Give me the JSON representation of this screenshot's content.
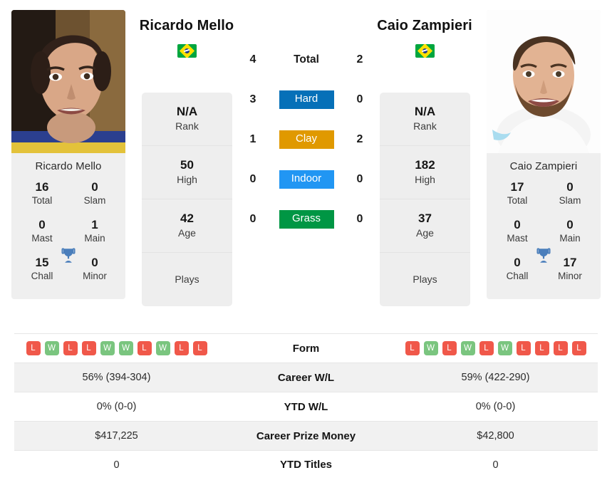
{
  "players": {
    "left": {
      "name": "Ricardo Mello",
      "photo_name": "Ricardo Mello",
      "flag": "brazil-flag",
      "rank": "N/A",
      "rank_label": "Rank",
      "high": "50",
      "high_label": "High",
      "age": "42",
      "age_label": "Age",
      "plays": "",
      "plays_label": "Plays",
      "titles": {
        "total": "16",
        "total_label": "Total",
        "slam": "0",
        "slam_label": "Slam",
        "mast": "0",
        "mast_label": "Mast",
        "main": "1",
        "main_label": "Main",
        "chall": "15",
        "chall_label": "Chall",
        "minor": "0",
        "minor_label": "Minor"
      },
      "form": [
        "L",
        "W",
        "L",
        "L",
        "W",
        "W",
        "L",
        "W",
        "L",
        "L"
      ],
      "career_wl": "56% (394-304)",
      "ytd_wl": "0% (0-0)",
      "career_prize": "$417,225",
      "ytd_titles": "0"
    },
    "right": {
      "name": "Caio Zampieri",
      "photo_name": "Caio Zampieri",
      "flag": "brazil-flag",
      "rank": "N/A",
      "rank_label": "Rank",
      "high": "182",
      "high_label": "High",
      "age": "37",
      "age_label": "Age",
      "plays": "",
      "plays_label": "Plays",
      "titles": {
        "total": "17",
        "total_label": "Total",
        "slam": "0",
        "slam_label": "Slam",
        "mast": "0",
        "mast_label": "Mast",
        "main": "0",
        "main_label": "Main",
        "chall": "0",
        "chall_label": "Chall",
        "minor": "17",
        "minor_label": "Minor"
      },
      "form": [
        "L",
        "W",
        "L",
        "W",
        "L",
        "W",
        "L",
        "L",
        "L",
        "L"
      ],
      "career_wl": "59% (422-290)",
      "ytd_wl": "0% (0-0)",
      "career_prize": "$42,800",
      "ytd_titles": "0"
    }
  },
  "h2h": [
    {
      "label": "Total",
      "left": "4",
      "right": "2",
      "color": ""
    },
    {
      "label": "Hard",
      "left": "3",
      "right": "0",
      "color": "#0670b8"
    },
    {
      "label": "Clay",
      "left": "1",
      "right": "2",
      "color": "#e09900"
    },
    {
      "label": "Indoor",
      "left": "0",
      "right": "0",
      "color": "#2196f3"
    },
    {
      "label": "Grass",
      "left": "0",
      "right": "0",
      "color": "#009644"
    }
  ],
  "table": {
    "form_label": "Form",
    "career_wl_label": "Career W/L",
    "ytd_wl_label": "YTD W/L",
    "career_prize_label": "Career Prize Money",
    "ytd_titles_label": "YTD Titles"
  },
  "colors": {
    "win": "#7ac57f",
    "loss": "#f0584a",
    "hard": "#0670b8",
    "clay": "#e09900",
    "indoor": "#2196f3",
    "grass": "#009644",
    "trophy": "#4a7ebb",
    "card_bg": "#efefef"
  }
}
